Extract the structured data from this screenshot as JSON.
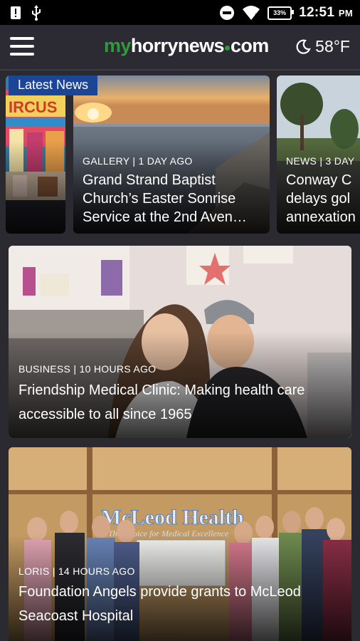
{
  "status_bar": {
    "time": "12:51",
    "ampm": "PM",
    "battery": "33%",
    "icons": [
      "alert-icon",
      "usb-icon",
      "dnd-icon",
      "wifi-icon",
      "battery-icon"
    ]
  },
  "app_bar": {
    "logo_my": "my",
    "logo_horrynews": "horrynews",
    "logo_com": "com",
    "weather_temp": "58°F",
    "weather_icon": "moon-icon"
  },
  "carousel": {
    "badge": "Latest News",
    "items": [
      {
        "category": "",
        "title": ""
      },
      {
        "category": "GALLERY | 1 DAY AGO",
        "title": "Grand Strand Baptist Church’s Easter Sonrise Service at the 2nd Aven…"
      },
      {
        "category": "NEWS | 3 DAY",
        "title": "Conway C delays gol annexation"
      }
    ]
  },
  "stories": [
    {
      "category": "BUSINESS | 10 HOURS AGO",
      "title": "Friendship Medical Clinic: Making health care accessible to all since 1965"
    },
    {
      "category": "LORIS | 14 HOURS AGO",
      "title": "Foundation Angels provide grants to McLeod Seacoast Hospital",
      "sign_text": "McLeod Health",
      "sign_sub": "The Choice for Medical Excellence"
    }
  ],
  "colors": {
    "background": "#2b2a31",
    "badge": "#1c4596",
    "logo_green": "#2e9a3a"
  }
}
